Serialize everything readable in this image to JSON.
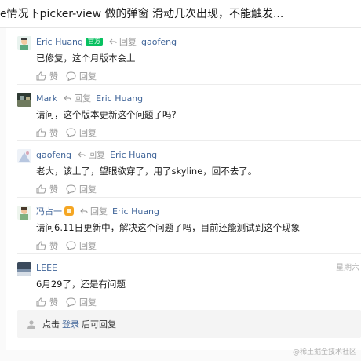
{
  "title": "e情况下picker-view 做的弹窗 滑动几次出现，不能触发...",
  "reply_word": "回复",
  "like_label": "赞",
  "comment_action_label": "回复",
  "comments": [
    {
      "author": "Eric Huang",
      "badge": "官方",
      "target": "gaofeng",
      "text": "已修复，这个月版本会上",
      "time": ""
    },
    {
      "author": "Mark",
      "badge": "",
      "target": "Eric Huang",
      "text": "请问，这个版本更新这个问题了吗?",
      "time": ""
    },
    {
      "author": "gaofeng",
      "badge": "",
      "target": "Eric Huang",
      "text": "老大，该上了，望眼欲穿了，用了skyline，回不去了。",
      "time": ""
    },
    {
      "author": "冯占一",
      "badge": "",
      "target": "Eric Huang",
      "text": "请问6.11日更新中，解决这个问题了吗，目前还能测试到这个现象",
      "time": ""
    },
    {
      "author": "LEEE",
      "badge": "",
      "target": "",
      "text": "6月29了，还是有问题",
      "time": "星期六"
    }
  ],
  "reply_box": {
    "prefix": "点击",
    "login": "登录",
    "suffix": "后可回复"
  },
  "watermark": "@稀土掘金技术社区",
  "colors": {
    "link": "#406599",
    "official_badge": "#07c160",
    "muted": "#999999"
  }
}
